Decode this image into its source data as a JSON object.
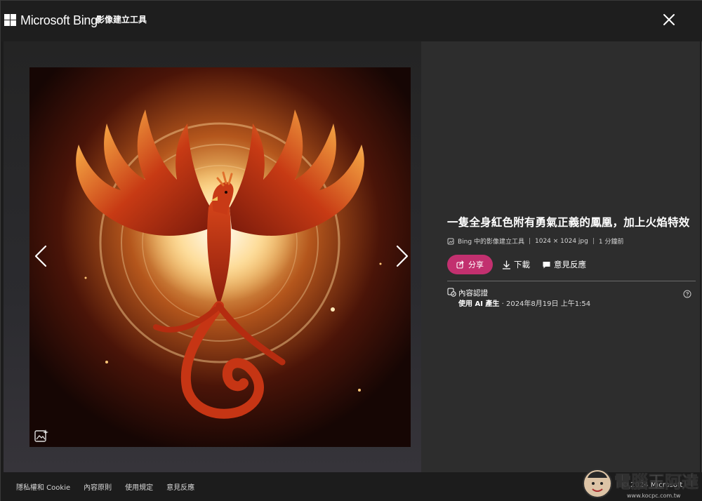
{
  "header": {
    "brand": "Microsoft Bing",
    "sub_brand": "影像建立工具",
    "close_icon": "close-icon"
  },
  "viewer": {
    "image_icon": "image-ai-icon",
    "prev_icon": "chevron-left-icon",
    "next_icon": "chevron-right-icon"
  },
  "details": {
    "title": "一隻全身紅色附有勇氣正義的鳳凰，加上火焰特效",
    "meta_source": "Bing 中的影像建立工具",
    "meta_size": "1024 × 1024 jpg",
    "meta_time": "1 分鐘前",
    "share_label": "分享",
    "download_label": "下載",
    "feedback_label": "意見反應",
    "credentials_title": "內容認證",
    "credentials_prefix": "使用 AI 產生",
    "credentials_date": " · 2024年8月19日 上午1:54"
  },
  "footer": {
    "links": [
      "隱私權和 Cookie",
      "內容原則",
      "使用規定",
      "意見反應"
    ],
    "copyright": "© 2024 Microsoft"
  },
  "watermark": {
    "text": "電腦王阿達",
    "url": "www.kocpc.com.tw"
  },
  "colors": {
    "accent": "#c2306f",
    "background": "#1c1c1c",
    "panel": "#2d2d2d"
  }
}
